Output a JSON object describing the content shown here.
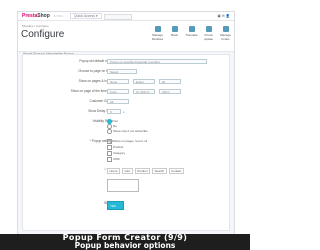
{
  "app": {
    "logo_brand": "Presta",
    "logo_rest": "Shop",
    "version": "1.7.6.x",
    "quick_access": "Quick Access ▾",
    "top_icons": "▣  ✉  👤"
  },
  "header": {
    "breadcrumb": "Modules  /  Configure",
    "title": "Configure",
    "subtitle": "Smart Popups Newsletter Popup",
    "buttons": [
      {
        "label": "Manage Modules"
      },
      {
        "label": "Back"
      },
      {
        "label": "Translate"
      },
      {
        "label": "Check update"
      },
      {
        "label": "Manage hooks"
      }
    ]
  },
  "form": {
    "fields": [
      {
        "label": "Popup set default name",
        "value": "Popup on specified page/ad reminder"
      },
      {
        "label": "Choose to page on hook",
        "value": "Select"
      },
      {
        "label": "Show on pages & hooks",
        "value": "None",
        "value2": "Entire",
        "value3": "all"
      },
      {
        "label": "Show on page of the time rule",
        "value": "From",
        "value2": "To (h/d/m)",
        "value3": "h/d/m"
      },
      {
        "label": "Customer Group",
        "value": "All"
      },
      {
        "label": "Show Delay Time",
        "value": "0",
        "value2": "s"
      }
    ],
    "visibility_label": "Visibility Rules",
    "visibility_options": [
      "Yes",
      "No",
      "Show only if not subscribe"
    ],
    "behavior_label": "* Popup settings",
    "behavior_options": [
      {
        "label": "Show on pages",
        "note": "Select all"
      },
      {
        "label": "Product"
      },
      {
        "label": "Category"
      },
      {
        "label": "CMS"
      }
    ],
    "tags_label": "* Tags",
    "tags": [
      "Home",
      "Cart",
      "Product",
      "Search",
      "Contact"
    ],
    "status_label": "Status",
    "status_value": "YES"
  },
  "banner": {
    "line1": "Popup Form Creator (9/9)",
    "line2": "Popup behavior options"
  },
  "colors": {
    "accent": "#25b9d7",
    "brand": "#df0067",
    "banner_bg": "#1e1e1e"
  }
}
